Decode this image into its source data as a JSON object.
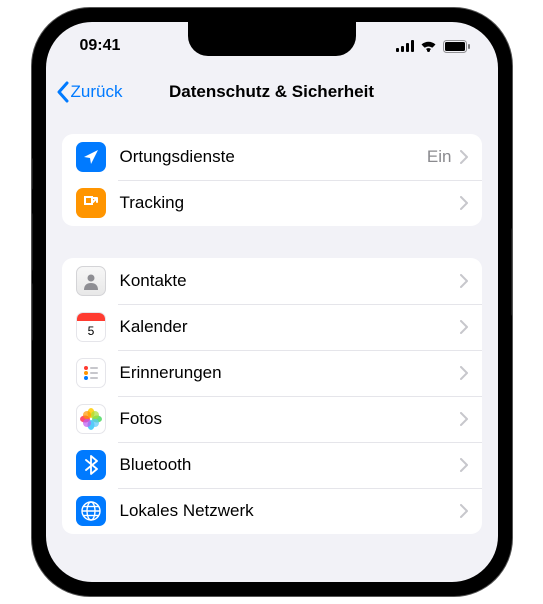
{
  "status": {
    "time": "09:41"
  },
  "nav": {
    "back": "Zurück",
    "title": "Datenschutz & Sicherheit"
  },
  "groups": [
    {
      "rows": [
        {
          "icon": "location",
          "label": "Ortungsdienste",
          "value": "Ein"
        },
        {
          "icon": "tracking",
          "label": "Tracking",
          "value": ""
        }
      ]
    },
    {
      "rows": [
        {
          "icon": "contacts",
          "label": "Kontakte",
          "value": ""
        },
        {
          "icon": "calendar",
          "label": "Kalender",
          "value": ""
        },
        {
          "icon": "reminders",
          "label": "Erinnerungen",
          "value": ""
        },
        {
          "icon": "photos",
          "label": "Fotos",
          "value": ""
        },
        {
          "icon": "bluetooth",
          "label": "Bluetooth",
          "value": ""
        },
        {
          "icon": "network",
          "label": "Lokales Netzwerk",
          "value": ""
        }
      ]
    }
  ]
}
